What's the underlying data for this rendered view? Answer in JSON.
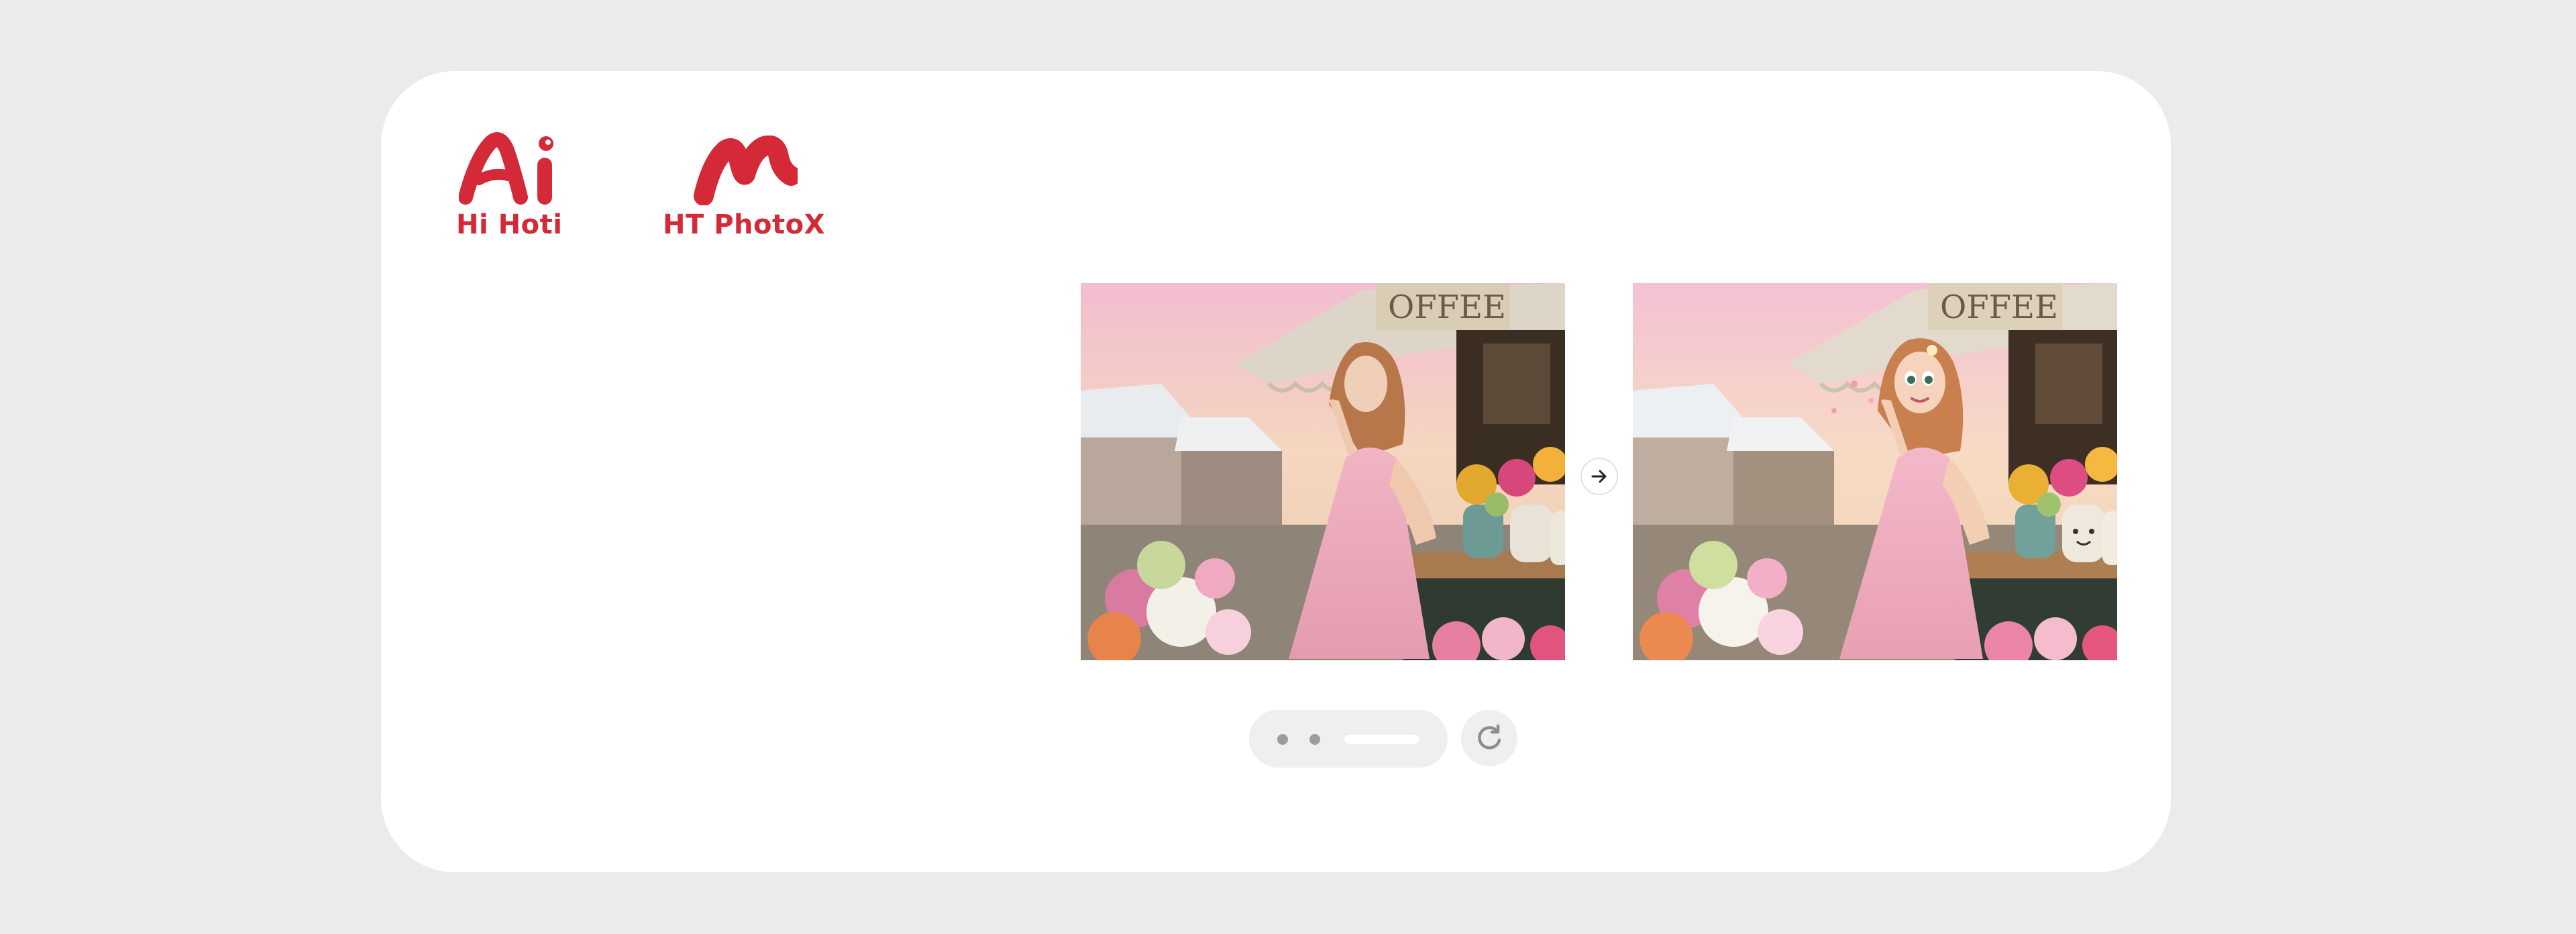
{
  "logos": [
    {
      "label": "Hi Hoti",
      "icon": "hi-hoti-logo-icon"
    },
    {
      "label": "HT PhotoX",
      "icon": "ht-photox-logo-icon"
    }
  ],
  "comparison": {
    "before_image": "original-photo-woman-pink-dress-flower-market",
    "after_image": "cartoon-stylized-photo-woman-pink-dress-flower-market",
    "sign_text": "OFFEE",
    "arrow_icon": "arrow-right-icon"
  },
  "carousel": {
    "slide_count": 3,
    "active_index": 2,
    "refresh_icon": "refresh-icon"
  },
  "colors": {
    "brand_red": "#d42a38",
    "background": "#ebebeb",
    "card": "#ffffff",
    "control_bg": "#efefef"
  }
}
